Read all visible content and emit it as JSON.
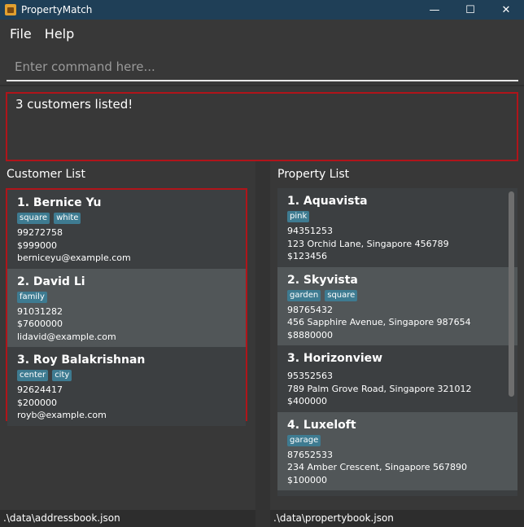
{
  "window": {
    "title": "PropertyMatch",
    "minimize_glyph": "—",
    "maximize_glyph": "☐",
    "close_glyph": "✕"
  },
  "menu": {
    "items": [
      "File",
      "Help"
    ]
  },
  "command": {
    "placeholder": "Enter command here...",
    "value": ""
  },
  "result": {
    "text": "3 customers listed!"
  },
  "customers": {
    "title": "Customer List",
    "items": [
      {
        "name": "1.  Bernice Yu",
        "tags": [
          "square",
          "white"
        ],
        "phone": "99272758",
        "budget": "$999000",
        "email": "berniceyu@example.com"
      },
      {
        "name": "2.  David Li",
        "tags": [
          "family"
        ],
        "phone": "91031282",
        "budget": "$7600000",
        "email": "lidavid@example.com"
      },
      {
        "name": "3.  Roy Balakrishnan",
        "tags": [
          "center",
          "city"
        ],
        "phone": "92624417",
        "budget": "$200000",
        "email": "royb@example.com"
      }
    ]
  },
  "properties": {
    "title": "Property List",
    "items": [
      {
        "name": "1.  Aquavista",
        "tags": [
          "pink"
        ],
        "phone": "94351253",
        "address": "123 Orchid Lane, Singapore 456789",
        "price": "$123456"
      },
      {
        "name": "2.  Skyvista",
        "tags": [
          "garden",
          "square"
        ],
        "phone": "98765432",
        "address": "456 Sapphire Avenue, Singapore 987654",
        "price": "$8880000"
      },
      {
        "name": "3.  Horizonview",
        "tags": [],
        "phone": "95352563",
        "address": "789 Palm Grove Road, Singapore 321012",
        "price": "$400000"
      },
      {
        "name": "4.  Luxeloft",
        "tags": [
          "garage"
        ],
        "phone": "87652533",
        "address": "234 Amber Crescent, Singapore 567890",
        "price": "$100000"
      }
    ]
  },
  "status": {
    "left": ".\\data\\addressbook.json",
    "right": ".\\data\\propertybook.json"
  },
  "colors": {
    "titlebar": "#1f3f57",
    "tag": "#3e7b91",
    "highlight_border": "#b0141a"
  }
}
